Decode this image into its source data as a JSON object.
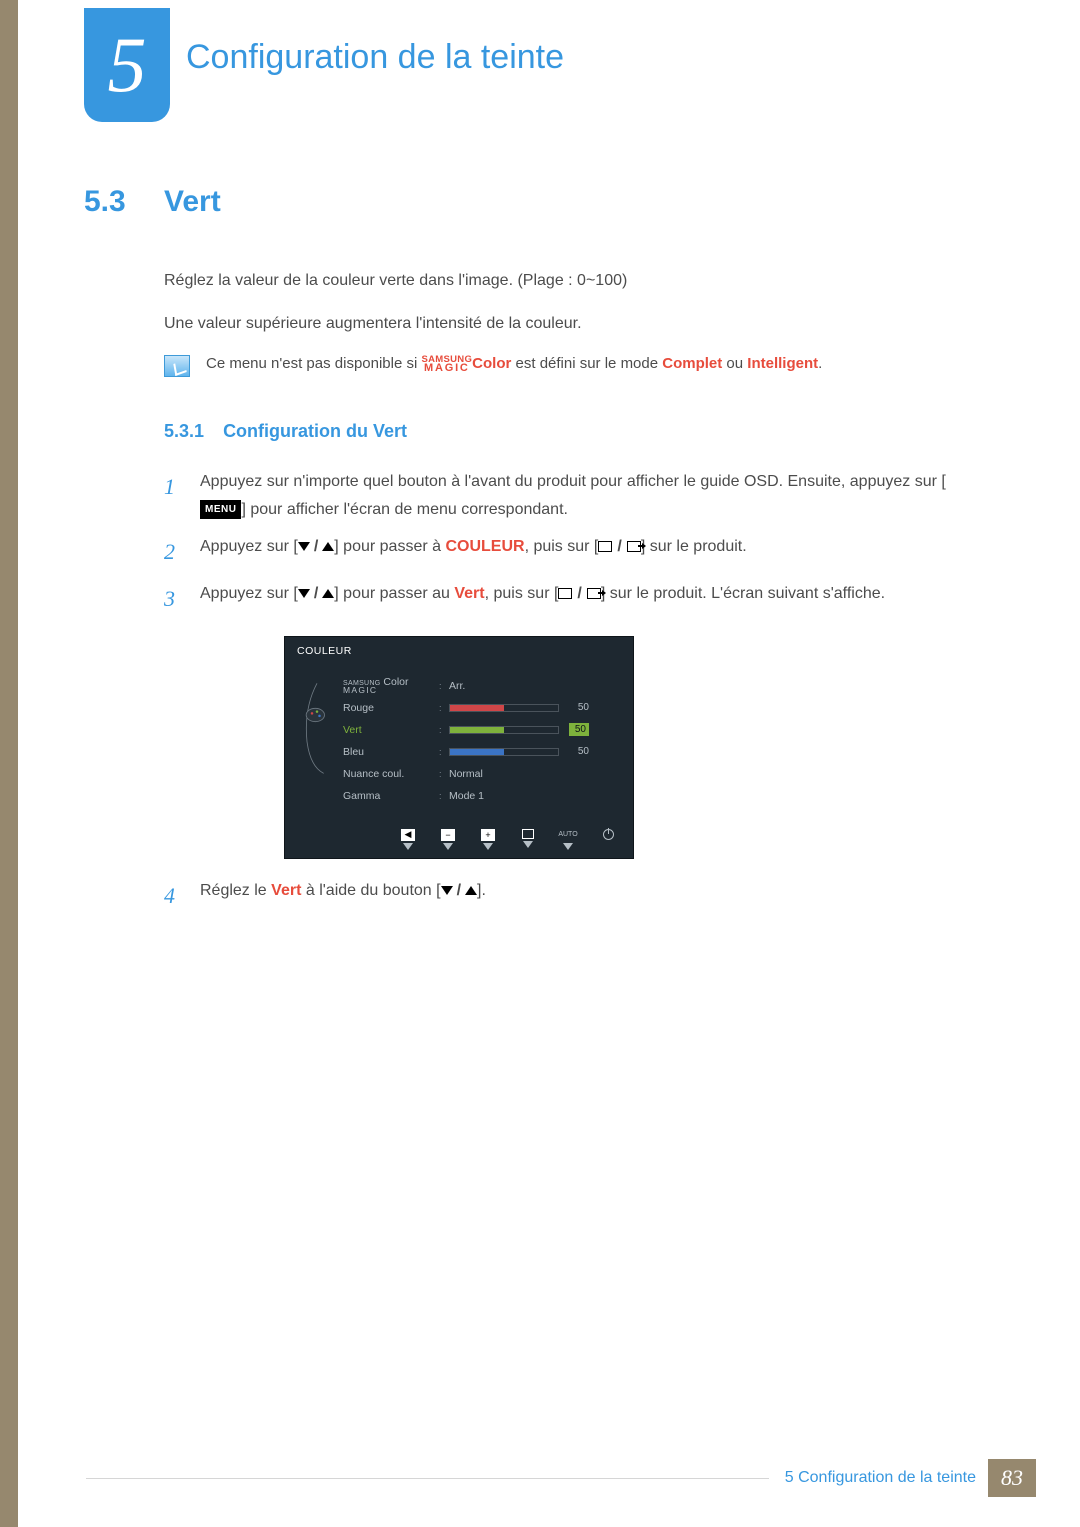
{
  "chapter": {
    "number": "5",
    "title": "Configuration de la teinte"
  },
  "section": {
    "number": "5.3",
    "title": "Vert"
  },
  "intro": {
    "p1": "Réglez la valeur de la couleur verte dans l'image. (Plage : 0~100)",
    "p2": "Une valeur supérieure augmentera l'intensité de la couleur."
  },
  "note": {
    "pre": "Ce menu n'est pas disponible si ",
    "magic_top": "SAMSUNG",
    "magic_bot": "MAGIC",
    "magic_suffix": "Color",
    "mid": " est défini sur le mode ",
    "complet": "Complet",
    "ou": " ou ",
    "intelligent": "Intelligent",
    "post": "."
  },
  "subsection": {
    "number": "5.3.1",
    "title": "Configuration du Vert"
  },
  "steps": {
    "s1a": "Appuyez sur n'importe quel bouton à l'avant du produit pour afficher le guide OSD. Ensuite, appuyez sur [",
    "s1_menu": "MENU",
    "s1b": "] pour afficher l'écran de menu correspondant.",
    "s2a": "Appuyez sur [",
    "s2b": "] pour passer à ",
    "s2_kw": "COULEUR",
    "s2c": ", puis sur [",
    "s2d": "] sur le produit.",
    "s3a": "Appuyez sur [",
    "s3b": "] pour passer au ",
    "s3_kw": "Vert",
    "s3c": ", puis sur [",
    "s3d": "] sur le produit. L'écran suivant s'affiche.",
    "s4a": "Réglez le ",
    "s4_kw": "Vert",
    "s4b": " à l'aide du bouton [",
    "s4c": "]."
  },
  "osd": {
    "title": "COULEUR",
    "magic_top": "SAMSUNG",
    "magic_bot": "MAGIC",
    "magic_suffix": " Color",
    "magic_val": "Arr.",
    "rouge": "Rouge",
    "rouge_val": "50",
    "vert": "Vert",
    "vert_val": "50",
    "bleu": "Bleu",
    "bleu_val": "50",
    "nuance": "Nuance coul.",
    "nuance_val": "Normal",
    "gamma": "Gamma",
    "gamma_val": "Mode 1",
    "auto": "AUTO"
  },
  "chart_data": {
    "type": "bar",
    "title": "COULEUR",
    "categories": [
      "Rouge",
      "Vert",
      "Bleu"
    ],
    "values": [
      50,
      50,
      50
    ],
    "ylim": [
      0,
      100
    ],
    "xlabel": "",
    "ylabel": ""
  },
  "footer": {
    "text": "5 Configuration de la teinte",
    "page": "83"
  }
}
